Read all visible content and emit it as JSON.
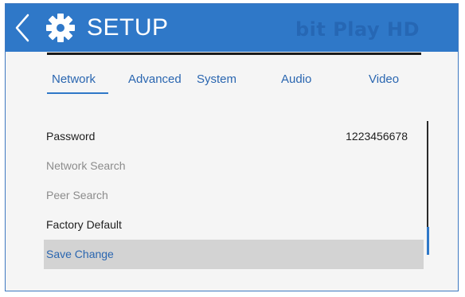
{
  "header": {
    "title": "SETUP",
    "brand": "bit Play HD",
    "back_icon": "chevron-left-icon",
    "settings_icon": "gear-icon"
  },
  "tabs": [
    {
      "label": "Network",
      "active": true
    },
    {
      "label": "Advanced",
      "active": false
    },
    {
      "label": "System",
      "active": false
    },
    {
      "label": "Audio",
      "active": false
    },
    {
      "label": "Video",
      "active": false
    }
  ],
  "settings": [
    {
      "label": "Password",
      "value": "1223456678",
      "state": "enabled"
    },
    {
      "label": "Network Search",
      "state": "disabled"
    },
    {
      "label": "Peer Search",
      "state": "disabled"
    },
    {
      "label": "Factory Default",
      "state": "enabled"
    },
    {
      "label": "Save Change",
      "state": "selected"
    }
  ],
  "colors": {
    "header_bg": "#2f78c8",
    "accent": "#2a66b0",
    "brand_text": "#2667b4",
    "selected_row": "#d3d3d3",
    "disabled_text": "#8c8c8c"
  }
}
